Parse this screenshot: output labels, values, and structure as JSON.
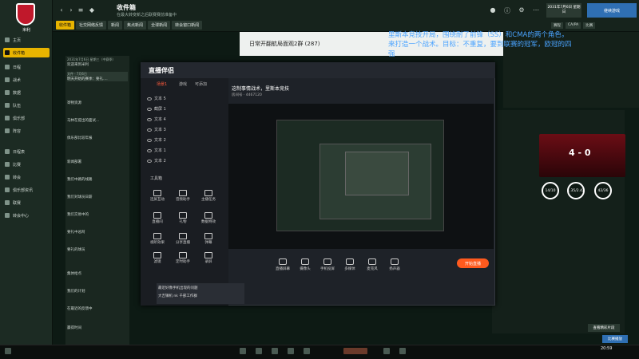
{
  "fm": {
    "club_short": "米利",
    "inbox_title": "收件箱",
    "inbox_sub": "在最大转变新之后联赛赛前准备中",
    "tabs": [
      "收件箱",
      "社交网络反馈",
      "新闻",
      "焦点新闻",
      "全球新闻",
      "转会窗口新闻"
    ],
    "sidebar": [
      "主页",
      "收件箱",
      "日程",
      "战术",
      "数据",
      "队伍",
      "俱乐部",
      "阵容",
      "日程表",
      "比赛",
      "转会",
      "俱乐部资讯",
      "联赛",
      "转会中心"
    ],
    "date": "2031年7月6日 星期日",
    "continue": "继续游戏",
    "right_tabs": [
      "赛程",
      "CA/PA",
      "比赛"
    ],
    "inbox_items": [
      {
        "t": "2031年7月6日 星期三（中赛季）",
        "s": "欢迎来到米利"
      },
      {
        "t": "文件 · 7月6日 ",
        "s": "明天开始的赛季：要礼...."
      },
      {
        "t": "",
        "s": "寄物资源"
      },
      {
        "t": "",
        "s": "马林在提出的面试..."
      },
      {
        "t": "",
        "s": "俱乐部比较年报"
      },
      {
        "t": "",
        "s": "新闻部署"
      },
      {
        "t": "",
        "s": "我们中路的线路"
      },
      {
        "t": "",
        "s": "我们对球员日薪"
      },
      {
        "t": "",
        "s": "我们交易中的"
      },
      {
        "t": "",
        "s": "要礼中总阿"
      },
      {
        "t": "",
        "s": "要礼的球员"
      },
      {
        "t": "",
        "s": "集体给点"
      },
      {
        "t": "",
        "s": "我们的计划"
      },
      {
        "t": "",
        "s": "在最近的反馈中"
      },
      {
        "t": "",
        "s": "赢得时间"
      }
    ],
    "detail_title": "日常开翻航局面观2群 (287)",
    "score": "4 - 0",
    "rings": [
      "14/10",
      "1.35/2.42",
      "42/36"
    ],
    "bottom_btn1": "查看精彩片段",
    "bottom_btn2": "比赛播放"
  },
  "annotation": "里斯本竞技开局，围绕耐了前锋（SS）和CMA的两个角色，来打造一个战术。目标：不重复，要到联赛的冠军，欧冠的四强",
  "stream": {
    "app_name": "直播伴侣",
    "scene_tabs": [
      "场景1",
      "游戏",
      "可添加"
    ],
    "sources": [
      "文本 5",
      "截屏 1",
      "文本 4",
      "文本 3",
      "文本 2",
      "文本 1",
      "文本 2"
    ],
    "tools_label": "工具箱",
    "tools": [
      "连屏互动",
      "音频助手",
      "主播任务",
      "直播间",
      "礼物",
      "数据特效",
      "视听效果",
      "分享直播",
      "弹幕",
      "滤镜",
      "定时助手",
      "录屏",
      "视频提示",
      "弹幕姬",
      "更多"
    ],
    "title": "这制事情战术，里斯本竞技",
    "room": "房间号 · 4467120",
    "bottom_buttons": [
      "直播屏幕",
      "摄像头",
      "手机投屏",
      "多媒体",
      "麦克风",
      "扬声器"
    ],
    "go_live": "开始直播",
    "chat1": "最近好像手机出现的问题",
    "chat2": "大吉镇机 nk 千部工作群"
  },
  "taskbar": {
    "clock": "20:59"
  }
}
